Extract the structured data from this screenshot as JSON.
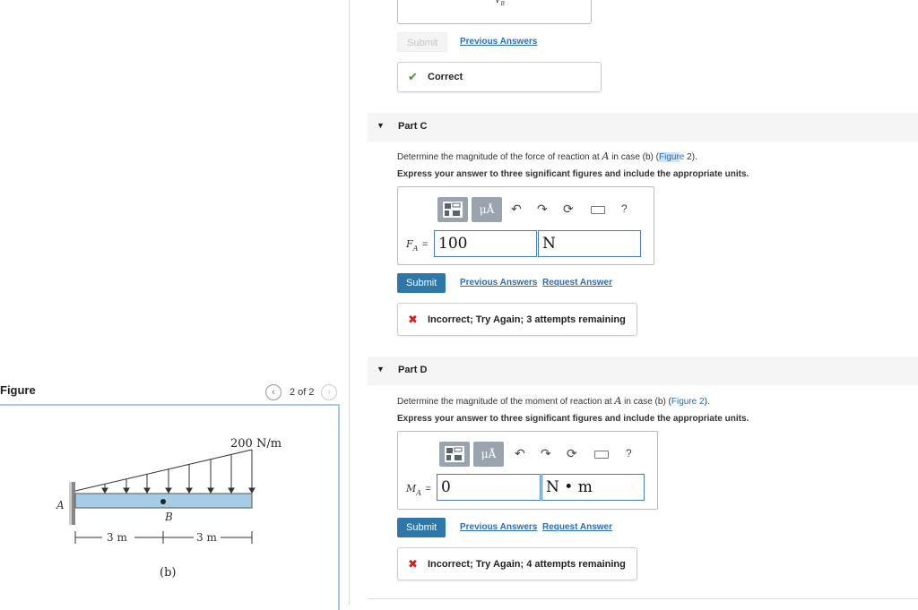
{
  "figure_panel": {
    "title": "Figure",
    "counter": "2 of 2",
    "prev_icon": "chevron-left-icon",
    "next_icon": "chevron-right-icon",
    "diagram": {
      "load_label": "200 N/m",
      "support_label": "A",
      "point_label": "B",
      "dim_left": "3 m",
      "dim_right": "3 m",
      "case_label": "(b)"
    }
  },
  "part_b_tail": {
    "submit_label": "Submit",
    "previous_answers": "Previous Answers",
    "feedback": "Correct",
    "feedback_icon": "checkmark-icon",
    "input_glyph": "V",
    "input_glyph_sub": "B"
  },
  "part_c": {
    "title": "Part C",
    "question_pre": "Determine the magnitude of the force of reaction at ",
    "question_var": "A",
    "question_mid": " in case (b) (",
    "question_link_a": "Figur",
    "question_link_b": "e",
    "question_link_c": " 2",
    "question_post": ").",
    "instructions": "Express your answer to three significant figures and include the appropriate units.",
    "var_label": "F",
    "var_sub": "A",
    "equals": "=",
    "value": "100",
    "unit": "N",
    "submit_label": "Submit",
    "previous_answers": "Previous Answers",
    "request_answer": "Request Answer",
    "feedback": "Incorrect; Try Again; 3 attempts remaining",
    "feedback_icon": "x-icon"
  },
  "part_d": {
    "title": "Part D",
    "question_pre": "Determine the magnitude of the moment of reaction at ",
    "question_var": "A",
    "question_mid": " in case (b) (",
    "question_link": "Figure 2",
    "question_post": ").",
    "instructions": "Express your answer to three significant figures and include the appropriate units.",
    "var_label": "M",
    "var_sub": "A",
    "equals": "=",
    "value": "0",
    "unit": "N • m",
    "submit_label": "Submit",
    "previous_answers": "Previous Answers",
    "request_answer": "Request Answer",
    "feedback": "Incorrect; Try Again; 4 attempts remaining",
    "feedback_icon": "x-icon"
  },
  "toolbar": {
    "units_label": "μÅ",
    "help_label": "?",
    "icons": [
      "templates-icon",
      "units-icon",
      "undo-icon",
      "redo-icon",
      "reset-icon",
      "keyboard-icon",
      "help-icon"
    ]
  },
  "colors": {
    "accent": "#2e77a8",
    "link": "#2a6db3",
    "correct": "#3a9a3a",
    "incorrect": "#cc2222",
    "figure_border": "#a9c9ec",
    "beam_fill": "#a7cde6"
  }
}
